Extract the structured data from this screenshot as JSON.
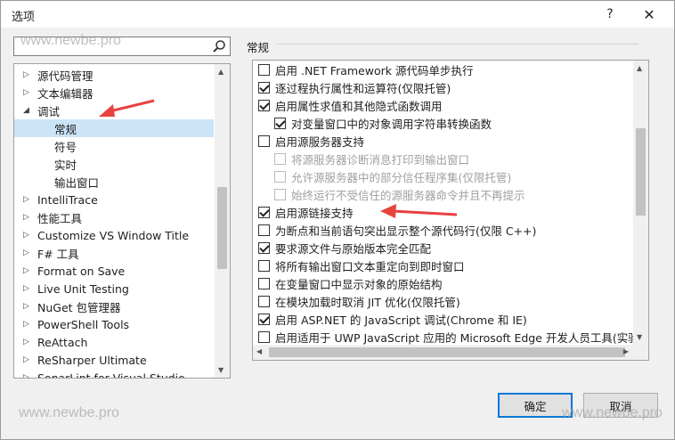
{
  "window": {
    "title": "选项",
    "help": "?",
    "close": "✕"
  },
  "search": {
    "value": "",
    "placeholder": ""
  },
  "tree": {
    "items": [
      {
        "label": "源代码管理",
        "expander": "▷"
      },
      {
        "label": "文本编辑器",
        "expander": "▷"
      },
      {
        "label": "调试",
        "expander": "◢"
      },
      {
        "label": "常规",
        "expander": ""
      },
      {
        "label": "符号",
        "expander": ""
      },
      {
        "label": "实时",
        "expander": ""
      },
      {
        "label": "输出窗口",
        "expander": ""
      },
      {
        "label": "IntelliTrace",
        "expander": "▷"
      },
      {
        "label": "性能工具",
        "expander": "▷"
      },
      {
        "label": "Customize VS Window Title",
        "expander": "▷"
      },
      {
        "label": "F# 工具",
        "expander": "▷"
      },
      {
        "label": "Format on Save",
        "expander": "▷"
      },
      {
        "label": "Live Unit Testing",
        "expander": "▷"
      },
      {
        "label": "NuGet 包管理器",
        "expander": "▷"
      },
      {
        "label": "PowerShell Tools",
        "expander": "▷"
      },
      {
        "label": "ReAttach",
        "expander": "▷"
      },
      {
        "label": "ReSharper Ultimate",
        "expander": "▷"
      },
      {
        "label": "SonarLint for Visual Studio",
        "expander": "▷"
      }
    ]
  },
  "section": {
    "title": "常规"
  },
  "options": [
    {
      "label": "启用 .NET Framework 源代码单步执行",
      "checked": false,
      "disabled": false
    },
    {
      "label": "逐过程执行属性和运算符(仅限托管)",
      "checked": true,
      "disabled": false
    },
    {
      "label": "启用属性求值和其他隐式函数调用",
      "checked": true,
      "disabled": false
    },
    {
      "label": "对变量窗口中的对象调用字符串转换函数",
      "checked": true,
      "disabled": false
    },
    {
      "label": "启用源服务器支持",
      "checked": false,
      "disabled": false
    },
    {
      "label": "将源服务器诊断消息打印到输出窗口",
      "checked": false,
      "disabled": true
    },
    {
      "label": "允许源服务器中的部分信任程序集(仅限托管)",
      "checked": false,
      "disabled": true
    },
    {
      "label": "始终运行不受信任的源服务器命令并且不再提示",
      "checked": false,
      "disabled": true
    },
    {
      "label": "启用源链接支持",
      "checked": true,
      "disabled": false
    },
    {
      "label": "为断点和当前语句突出显示整个源代码行(仅限 C++)",
      "checked": false,
      "disabled": false
    },
    {
      "label": "要求源文件与原始版本完全匹配",
      "checked": true,
      "disabled": false
    },
    {
      "label": "将所有输出窗口文本重定向到即时窗口",
      "checked": false,
      "disabled": false
    },
    {
      "label": "在变量窗口中显示对象的原始结构",
      "checked": false,
      "disabled": false
    },
    {
      "label": "在模块加载时取消 JIT 优化(仅限托管)",
      "checked": false,
      "disabled": false
    },
    {
      "label": "启用 ASP.NET 的 JavaScript 调试(Chrome 和 IE)",
      "checked": true,
      "disabled": false
    },
    {
      "label": "启用适用于 UWP JavaScript 应用的 Microsoft Edge 开发人员工具(实验版",
      "checked": false,
      "disabled": false
    }
  ],
  "buttons": {
    "ok": "确定",
    "cancel": "取消"
  },
  "watermark": "www.newbe.pro",
  "colors": {
    "selection": "#cce4f7",
    "arrow": "#e8423f",
    "accent": "#0078d7"
  }
}
